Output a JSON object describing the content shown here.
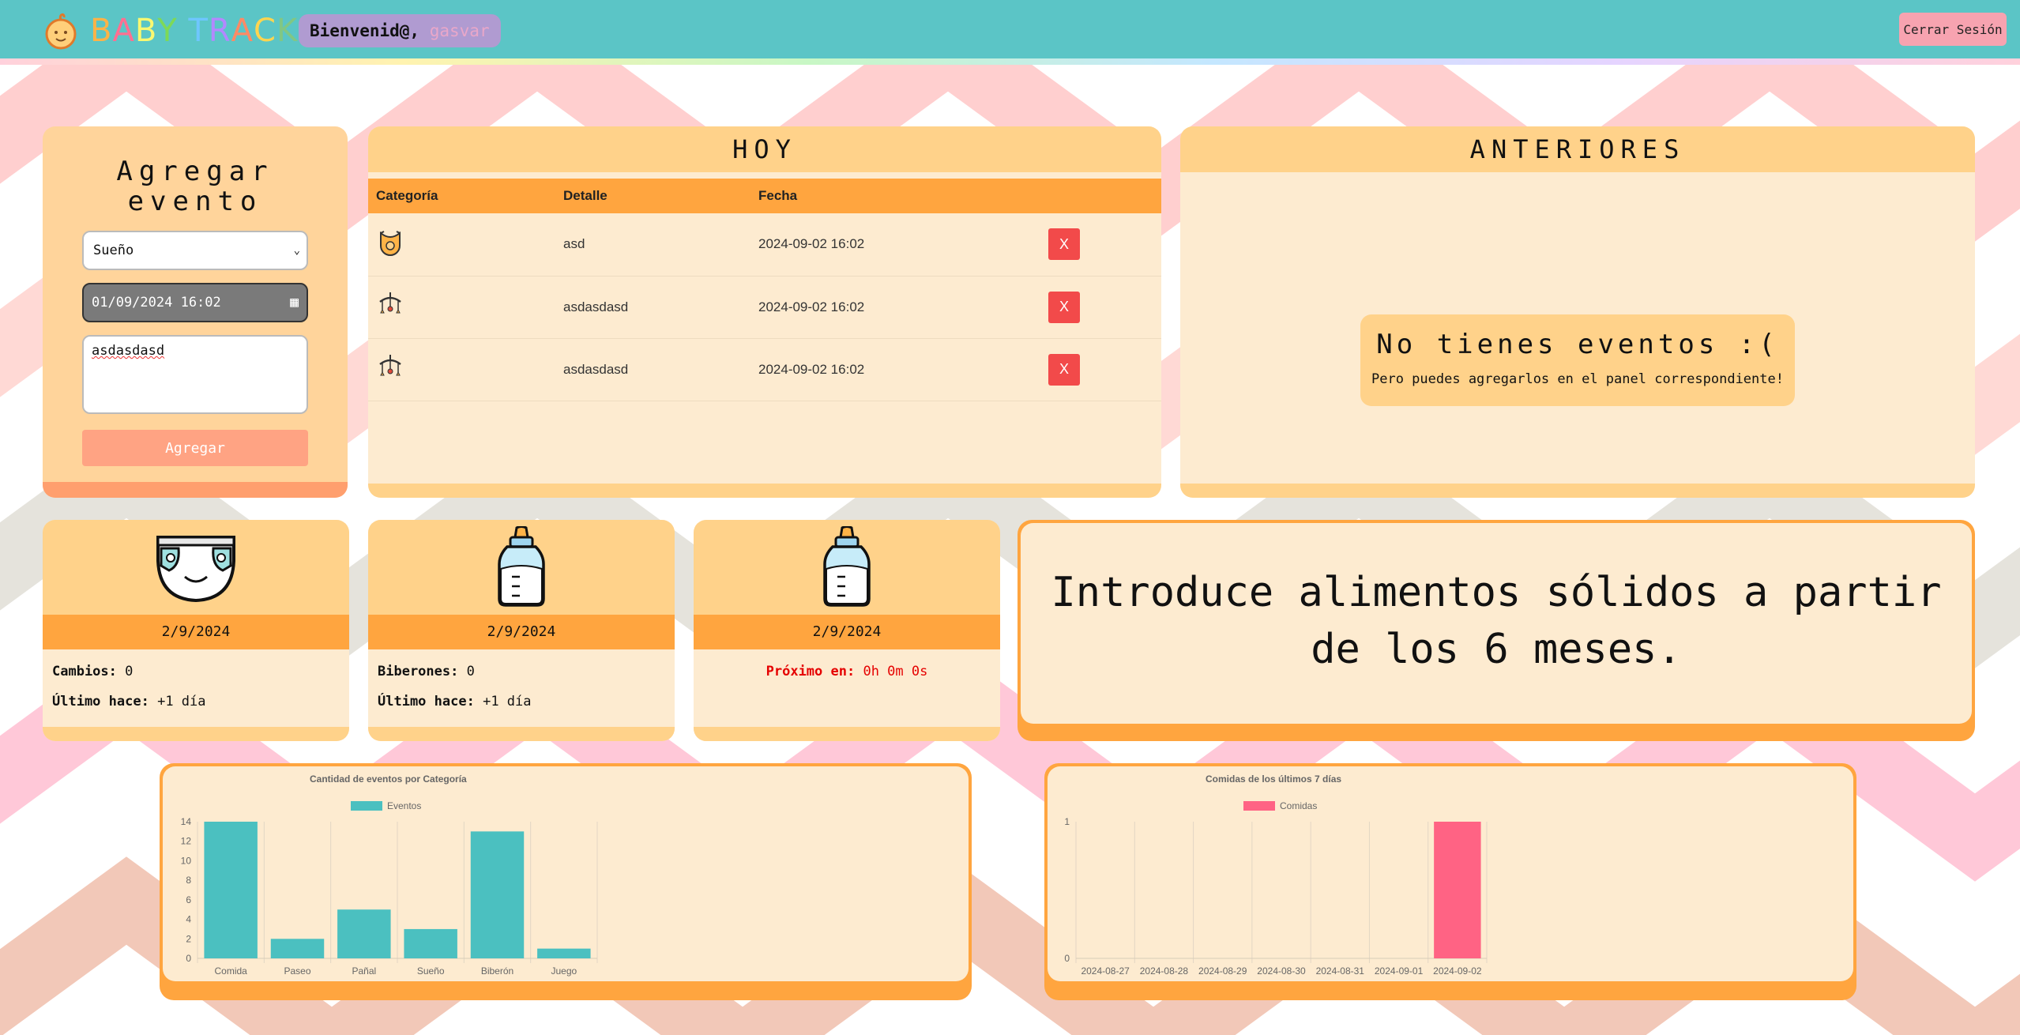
{
  "header": {
    "brand": "BABY TRACKER",
    "welcome_label": "Bienvenid@,",
    "username": "gasvar",
    "logout_label": "Cerrar Sesión"
  },
  "add_event": {
    "title": "Agregar evento",
    "category_value": "Sueño",
    "datetime_value": "01/09/2024 16:02",
    "detail_value": "asdasdasd",
    "submit_label": "Agregar"
  },
  "today": {
    "title": "HOY",
    "columns": [
      "Categoría",
      "Detalle",
      "Fecha"
    ],
    "rows": [
      {
        "icon": "bib-icon",
        "detail": "asd",
        "date": "2024-09-02 16:02",
        "delete": "X"
      },
      {
        "icon": "mobile-toy-icon",
        "detail": "asdasdasd",
        "date": "2024-09-02 16:02",
        "delete": "X"
      },
      {
        "icon": "mobile-toy-icon",
        "detail": "asdasdasd",
        "date": "2024-09-02 16:02",
        "delete": "X"
      }
    ]
  },
  "previous": {
    "title": "ANTERIORES",
    "empty_title": "No tienes eventos :(",
    "empty_subtitle": "Pero puedes agregarlos en el panel correspondiente!"
  },
  "stats": [
    {
      "icon": "diaper-icon",
      "date": "2/9/2024",
      "label1": "Cambios:",
      "value1": "0",
      "label2": "Último hace:",
      "value2": "+1 día"
    },
    {
      "icon": "baby-bottle-icon",
      "date": "2/9/2024",
      "label1": "Biberones:",
      "value1": "0",
      "label2": "Último hace:",
      "value2": "+1 día"
    },
    {
      "icon": "baby-bottle-icon",
      "date": "2/9/2024",
      "next_label": "Próximo en:",
      "next_value": "0h 0m 0s"
    }
  ],
  "tip": {
    "text": "Introduce alimentos sólidos a partir de los 6 meses."
  },
  "colors": {
    "topbar": "#5bc5c6",
    "card_bg": "#fdebd0",
    "card_head": "#ffd28a",
    "accent_orange": "#ffa53f",
    "delete_red": "#f24a4a",
    "teal_bar": "#4bc0c0",
    "pink_bar": "#ff6384"
  },
  "chart_data": [
    {
      "type": "bar",
      "title": "Cantidad de eventos por Categoría",
      "categories": [
        "Comida",
        "Paseo",
        "Pañal",
        "Sueño",
        "Biberón",
        "Juego"
      ],
      "series": [
        {
          "name": "Eventos",
          "values": [
            14,
            2,
            5,
            3,
            13,
            1
          ],
          "color": "#4bc0c0"
        }
      ],
      "ylim": [
        0,
        14
      ],
      "yticks": [
        0,
        2,
        4,
        6,
        8,
        10,
        12,
        14
      ],
      "legend": "top"
    },
    {
      "type": "bar",
      "title": "Comidas de los últimos 7 días",
      "categories": [
        "2024-08-27",
        "2024-08-28",
        "2024-08-29",
        "2024-08-30",
        "2024-08-31",
        "2024-09-01",
        "2024-09-02"
      ],
      "series": [
        {
          "name": "Comidas",
          "values": [
            0,
            0,
            0,
            0,
            0,
            0,
            1
          ],
          "color": "#ff6384"
        }
      ],
      "ylim": [
        0,
        1
      ],
      "yticks": [
        0,
        1
      ],
      "legend": "top"
    }
  ]
}
